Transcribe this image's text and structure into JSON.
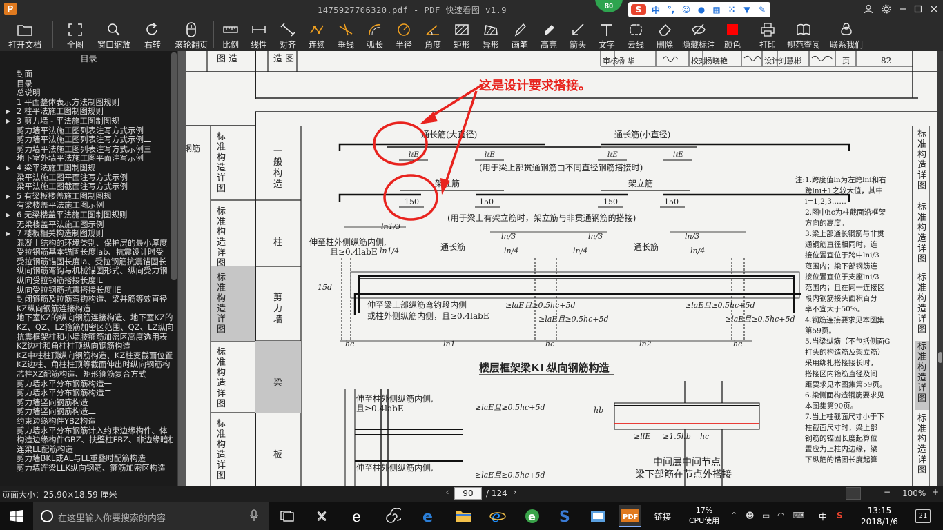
{
  "window": {
    "title": "1475927706320.pdf - PDF 快速看图 v1.9",
    "perf_badge": "80",
    "ime_lang": "中"
  },
  "toolbar": {
    "items": [
      {
        "label": "打开文档",
        "icon": "folder-icon"
      },
      {
        "label": "全图",
        "icon": "fit-page-icon"
      },
      {
        "label": "窗口缩放",
        "icon": "zoom-window-icon"
      },
      {
        "label": "右转",
        "icon": "rotate-right-icon"
      },
      {
        "label": "滚轮翻页",
        "icon": "mouse-wheel-icon"
      },
      {
        "label": "比例",
        "icon": "scale-icon"
      },
      {
        "label": "线性",
        "icon": "linear-dimension-icon"
      },
      {
        "label": "对齐",
        "icon": "aligned-dimension-icon"
      },
      {
        "label": "连续",
        "icon": "continuous-dimension-icon"
      },
      {
        "label": "垂线",
        "icon": "perpendicular-icon"
      },
      {
        "label": "弧长",
        "icon": "arc-length-icon"
      },
      {
        "label": "半径",
        "icon": "radius-icon"
      },
      {
        "label": "角度",
        "icon": "angle-icon"
      },
      {
        "label": "矩形",
        "icon": "rectangle-icon"
      },
      {
        "label": "异形",
        "icon": "polygon-icon"
      },
      {
        "label": "画笔",
        "icon": "pen-icon"
      },
      {
        "label": "高亮",
        "icon": "highlighter-icon"
      },
      {
        "label": "箭头",
        "icon": "arrow-icon"
      },
      {
        "label": "文字",
        "icon": "text-icon"
      },
      {
        "label": "云线",
        "icon": "cloud-line-icon"
      },
      {
        "label": "删除",
        "icon": "eraser-icon"
      },
      {
        "label": "隐藏标注",
        "icon": "hide-annotation-icon"
      },
      {
        "label": "颜色",
        "icon": "color-swatch-icon"
      },
      {
        "label": "打印",
        "icon": "printer-icon"
      },
      {
        "label": "规范查阅",
        "icon": "book-icon"
      },
      {
        "label": "联系我们",
        "icon": "contact-icon"
      }
    ]
  },
  "toc": {
    "header": "目录",
    "items": [
      {
        "text": "封面",
        "arrow": false
      },
      {
        "text": "目录",
        "arrow": false
      },
      {
        "text": "总说明",
        "arrow": false
      },
      {
        "text": "1  平面整体表示方法制图规则",
        "arrow": false
      },
      {
        "text": "2  柱平法施工图制图规则",
        "arrow": true
      },
      {
        "text": "3  剪力墙 - 平法施工图制图规",
        "arrow": true
      },
      {
        "text": "剪力墙平法施工图列表注写方式示例一",
        "arrow": false
      },
      {
        "text": "剪力墙平法施工图列表注写方式示例二",
        "arrow": false
      },
      {
        "text": "剪力墙平法施工图列表注写方式示例三",
        "arrow": false
      },
      {
        "text": "地下室外墙平法施工图平面注写示例",
        "arrow": false
      },
      {
        "text": "4  梁平法施工图制图规",
        "arrow": true
      },
      {
        "text": "梁平法施工图平面注写方式示例",
        "arrow": false
      },
      {
        "text": "梁平法施工图截面注写方式示例",
        "arrow": false
      },
      {
        "text": "5  有梁板楼盖施工图制图规",
        "arrow": true
      },
      {
        "text": "有梁楼盖平法施工图示例",
        "arrow": false
      },
      {
        "text": "6  无梁楼盖平法施工图制图规则",
        "arrow": true
      },
      {
        "text": "无梁楼盖平法施工图示例",
        "arrow": false
      },
      {
        "text": "7  楼板相关构造制图规则",
        "arrow": true
      },
      {
        "text": "混凝土结构的环境类别、保护层的最小厚度",
        "arrow": false
      },
      {
        "text": "受拉钢筋基本锚固长度lab、抗震设计时受",
        "arrow": false
      },
      {
        "text": "受拉钢筋锚固长度la、受拉钢筋抗震锚固长",
        "arrow": false
      },
      {
        "text": "纵向钢筋弯钩与机械锚固形式、纵向受力钢",
        "arrow": false
      },
      {
        "text": "纵向受拉钢筋搭接长度lL",
        "arrow": false
      },
      {
        "text": "纵向受拉钢筋抗震搭接长度llE",
        "arrow": false
      },
      {
        "text": "封闭箍筋及拉筋弯钩构造、梁并筋等效直径",
        "arrow": false
      },
      {
        "text": "KZ纵向钢筋连接构造",
        "arrow": false
      },
      {
        "text": "地下室KZ的纵向钢筋连接构造、地下室KZ的",
        "arrow": false
      },
      {
        "text": "KZ、QZ、LZ箍筋加密区范围、QZ、LZ纵向钢",
        "arrow": false
      },
      {
        "text": "抗震框架柱和小墙肢箍筋加密区高度选用表",
        "arrow": false
      },
      {
        "text": "KZ边柱和角柱柱顶纵向钢筋构造",
        "arrow": false
      },
      {
        "text": "KZ中柱柱顶纵向钢筋构造、KZ柱变截面位置",
        "arrow": false
      },
      {
        "text": "KZ边柱、角柱柱顶等截面伸出时纵向钢筋构",
        "arrow": false
      },
      {
        "text": "芯柱XZ配筋构造、矩形箍筋复合方式",
        "arrow": false
      },
      {
        "text": "剪力墙水平分布钢筋构造一",
        "arrow": false
      },
      {
        "text": "剪力墙水平分布钢筋构造二",
        "arrow": false
      },
      {
        "text": "剪力墙竖向钢筋构造一",
        "arrow": false
      },
      {
        "text": "剪力墙竖向钢筋构造二",
        "arrow": false
      },
      {
        "text": "约束边缘构件YBZ构造",
        "arrow": false
      },
      {
        "text": "剪力墙水平分布钢筋计入约束边缘构件、体",
        "arrow": false
      },
      {
        "text": "构造边缘构件GBZ、扶壁柱FBZ、非边缘暗柱",
        "arrow": false
      },
      {
        "text": "连梁LL配筋构造",
        "arrow": false
      },
      {
        "text": "剪力墙BKL或AL与LL重叠时配筋构造",
        "arrow": false
      },
      {
        "text": "剪力墙连梁LLK纵向钢筋、箍筋加密区构造",
        "arrow": false
      }
    ]
  },
  "document": {
    "top_left_cell_1": "图 造",
    "top_left_cell_2": "造 图",
    "approval_row": {
      "audit_label": "审核",
      "auditor": "杨  华",
      "proof_label": "校对",
      "proofer": "杨晓艳",
      "design_label": "设计",
      "designer": "刘慧彬",
      "page_label": "页",
      "page_no": "82"
    },
    "annotation_text": "这是设计要求搭接。",
    "left_edge_text": "钢筋",
    "row_labels": [
      {
        "vertical": "标准构造详图",
        "name": "一般构造"
      },
      {
        "vertical": "标准构造详图",
        "name": "柱"
      },
      {
        "vertical": "标准构造详图",
        "name": "剪力墙"
      },
      {
        "vertical": "标准构造详图",
        "name": "梁"
      },
      {
        "vertical": "标准构造详图",
        "name": "板"
      }
    ],
    "right_tabs": [
      "标准构造详图",
      "标准构造详图",
      "标准构造详图",
      "标准构造详图",
      "标准构造详图"
    ],
    "drawing": {
      "label_through_large": "通长筋(大直径)",
      "label_through_small": "通长筋(小直径)",
      "lap_label": "lℓE",
      "caption_1": "(用于梁上部贯通钢筋由不同直径钢筋搭接时)",
      "label_erect_1": "架立筋",
      "label_erect_2": "架立筋",
      "lap_150": "150",
      "caption_2": "(用于梁上有架立筋时，架立筋与非贯通钢筋的搭接)",
      "ln1_3": "ln1/3",
      "ln_3": "ln/3",
      "ln1_4": "ln1/4",
      "ln_4": "ln/4",
      "extend_1": "伸至柱外侧纵筋内侧,",
      "extend_2": "且≥0.4labE",
      "through_bar": "通长筋",
      "bottom_1": "伸至梁上部纵筋弯钩段内侧",
      "bottom_2": "或柱外侧纵筋内侧，且≥0.4labE",
      "cond_1": "≥laE且≥0.5hc+5d",
      "cond_2": "≥laE且≥0.5hc+5d",
      "cond_3": "≥laE且≥0.5hc+5d",
      "cond_4": "≥laE且≥0.5hc+5d",
      "dim_15d": "15d",
      "hc": "hc",
      "ln1": "ln1",
      "ln2": "ln2",
      "main_title": "楼层框架梁KL纵向钢筋构造",
      "sub_extend_1": "伸至柱外侧纵筋内侧,",
      "sub_extend_2": "且≥0.4labE",
      "sub_cond": "≥laE且≥0.5hc+5d",
      "sub_extend_3": "伸至柱外侧纵筋内侧,",
      "sub_cond_2": "≥laE且≥0.5hc+5d",
      "hb": "hb",
      "sub_lap": "≥llE",
      "sub_15hb": "≥1.5hb",
      "sub_hc": "hc",
      "node_title_1": "中间层中间节点",
      "node_title_2": "梁下部筋在节点外搭接"
    },
    "notes": [
      "注:1.跨度值ln为左跨lni和右",
      "跨lni+1之较大值，其中",
      "i=1,2,3……",
      "2.图中hc为柱截面沿框架",
      "方向的高度。",
      "3.梁上部通长钢筋与非贯",
      "通钢筋直径相同时，连",
      "接位置宜位于跨中lni/3",
      "范围内；梁下部钢筋连",
      "接位置宜位于支座lni/3",
      "范围内；且在同一连接区",
      "段内钢筋接头面积百分",
      "率不宜大于50%。",
      "4.钢筋连接要求见本图集",
      "第59页。",
      "5.当梁纵筋（不包括侧面G",
      "打头的构造筋及架立筋）",
      "采用绑扎搭接接长时，",
      "搭接区内箍筋直径及间",
      "距要求见本图集第59页。",
      "6.梁侧面构造钢筋要求见",
      "本图集第90页。",
      "7.当上柱截面尺寸小于下",
      "柱截面尺寸时，梁上部",
      "钢筋的锚固长度起算位",
      "置应为上柱内边缘，梁",
      "下纵筋的锚固长度起算"
    ]
  },
  "statusbar": {
    "page_size": "页面大小：25.90×18.59 厘米",
    "current_page": "90",
    "total_pages": "/ 124",
    "zoom": "100%"
  },
  "taskbar": {
    "search_placeholder": "在这里输入你要搜索的内容",
    "tray_link": "链接",
    "cpu_percent": "17%",
    "cpu_label": "CPU使用",
    "ime": "中",
    "time": "13:15",
    "date": "2018/1/6",
    "notifications": "21"
  },
  "colors": {
    "annotation_red": "#e8231e",
    "toolbar_icon_orange": "#f0a020",
    "color_swatch": "#ff0000"
  }
}
